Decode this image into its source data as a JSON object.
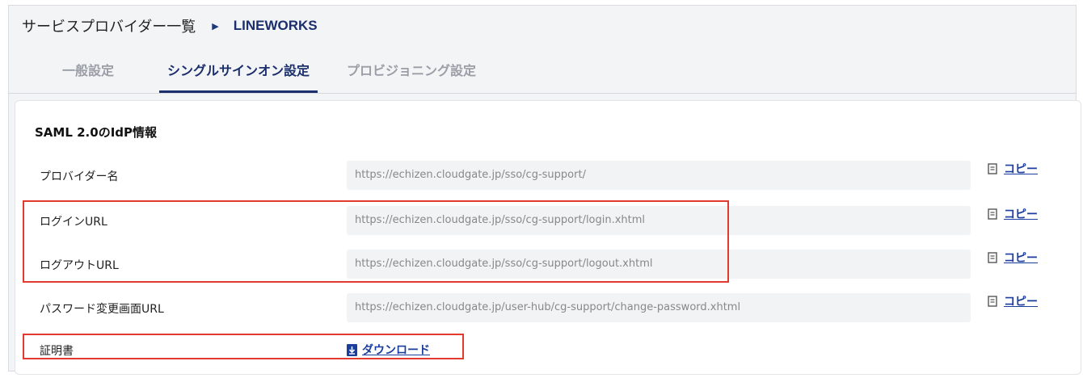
{
  "breadcrumb": {
    "root": "サービスプロバイダー一覧",
    "current": "LINEWORKS"
  },
  "tabs": [
    {
      "label": "一般設定",
      "active": false
    },
    {
      "label": "シングルサインオン設定",
      "active": true
    },
    {
      "label": "プロビジョニング設定",
      "active": false
    }
  ],
  "section": {
    "title": "SAML 2.0のIdP情報"
  },
  "rows": [
    {
      "label": "プロバイダー名",
      "value": "https://echizen.cloudgate.jp/sso/cg-support/",
      "copy_label": "コピー"
    },
    {
      "label": "ログインURL",
      "value": "https://echizen.cloudgate.jp/sso/cg-support/login.xhtml",
      "copy_label": "コピー"
    },
    {
      "label": "ログアウトURL",
      "value": "https://echizen.cloudgate.jp/sso/cg-support/logout.xhtml",
      "copy_label": "コピー"
    },
    {
      "label": "パスワード変更画面URL",
      "value": "https://echizen.cloudgate.jp/user-hub/cg-support/change-password.xhtml",
      "copy_label": "コピー"
    }
  ],
  "certificate": {
    "label": "証明書",
    "download_label": "ダウンロード"
  },
  "colors": {
    "accent": "#1a2f6b",
    "link": "#1b3d9e",
    "highlight": "#e23a2e"
  },
  "icons": {
    "breadcrumb_separator": "chevron-right-icon",
    "copy": "copy-icon",
    "download": "download-file-icon"
  }
}
